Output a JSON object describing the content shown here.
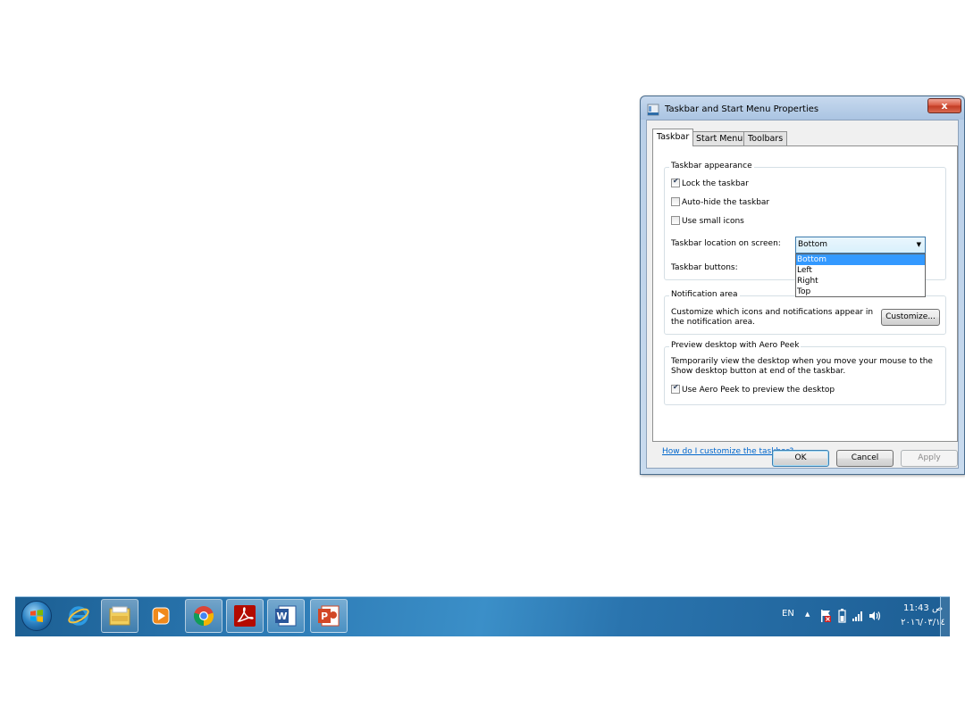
{
  "dialog": {
    "title": "Taskbar and Start Menu Properties",
    "close_label": "x",
    "tabs": [
      {
        "label": "Taskbar",
        "active": true
      },
      {
        "label": "Start Menu",
        "active": false
      },
      {
        "label": "Toolbars",
        "active": false
      }
    ],
    "appearance": {
      "title": "Taskbar appearance",
      "lock_taskbar": {
        "label": "Lock the taskbar",
        "checked": true
      },
      "auto_hide": {
        "label": "Auto-hide the taskbar",
        "checked": false
      },
      "small_icons": {
        "label": "Use small icons",
        "checked": false
      },
      "location_label": "Taskbar location on screen:",
      "location_value": "Bottom",
      "location_options": [
        "Bottom",
        "Left",
        "Right",
        "Top"
      ],
      "buttons_label": "Taskbar buttons:"
    },
    "notification": {
      "title": "Notification area",
      "text": "Customize which icons and notifications appear in the notification area.",
      "customize_button": "Customize..."
    },
    "aero_peek": {
      "title": "Preview desktop with Aero Peek",
      "text": "Temporarily view the desktop when you move your mouse to the Show desktop button at end of the taskbar.",
      "use_peek": {
        "label": "Use Aero Peek to preview the desktop",
        "checked": true
      }
    },
    "help_link": "How do I customize the taskbar?",
    "buttons": {
      "ok": "OK",
      "cancel": "Cancel",
      "apply": "Apply"
    }
  },
  "taskbar": {
    "pinned": [
      "start-orb",
      "internet-explorer",
      "windows-explorer",
      "media-player",
      "chrome",
      "adobe-reader",
      "word",
      "powerpoint"
    ],
    "language": "EN",
    "tray_up_arrow": "▲",
    "clock_time": "11:43 ص",
    "clock_date": "٢٠١٦/٠٣/١٤"
  }
}
